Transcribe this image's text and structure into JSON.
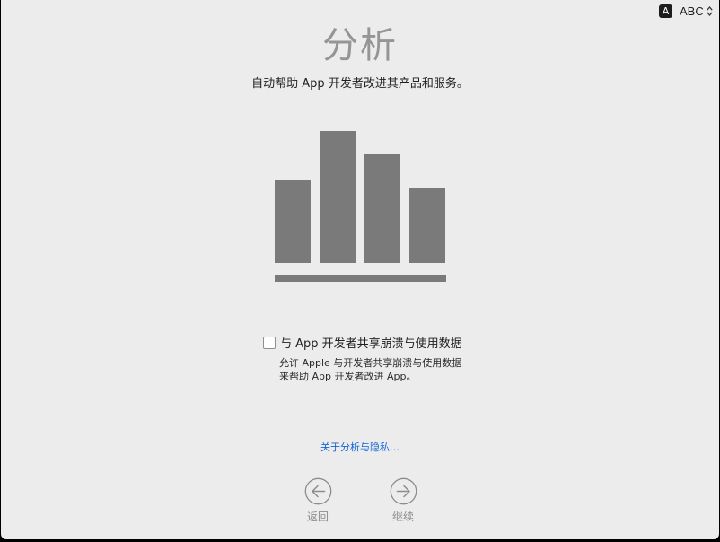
{
  "input_menu": {
    "badge": "A",
    "label": "ABC"
  },
  "page": {
    "title": "分析",
    "subtitle": "自动帮助 App 开发者改进其产品和服务。"
  },
  "illustration": {
    "icon": "bar-chart-icon",
    "color": "#7a7a7a"
  },
  "consent": {
    "checkbox_label": "与 App 开发者共享崩溃与使用数据",
    "checked": false,
    "description_line1": "允许 Apple 与开发者共享崩溃与使用数据",
    "description_line2": "来帮助 App 开发者改进 App。"
  },
  "privacy_link": "关于分析与隐私…",
  "navigation": {
    "back_label": "返回",
    "continue_label": "继续"
  },
  "colors": {
    "background": "#ececec",
    "link": "#1463d6",
    "title": "#959595",
    "nav": "#8d8d8d"
  }
}
